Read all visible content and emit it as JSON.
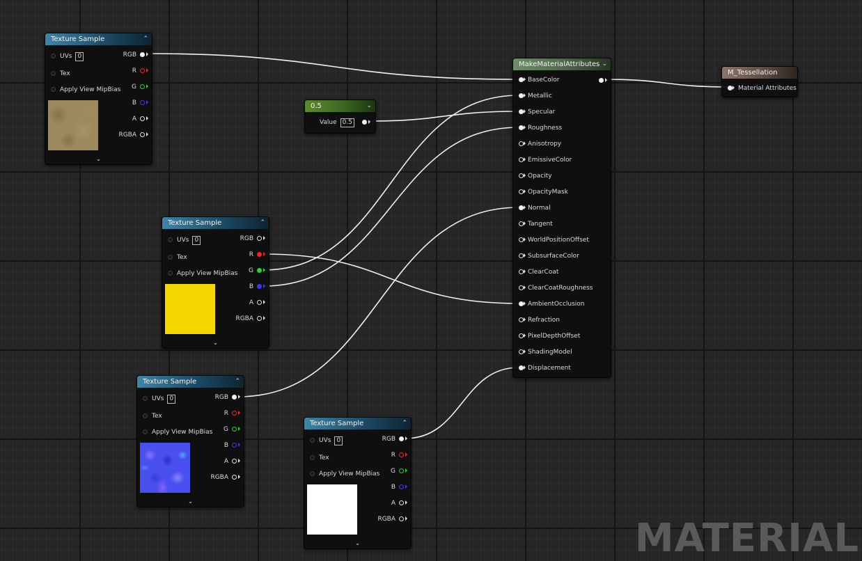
{
  "watermark": "MATERIAL",
  "texture_sample": {
    "title": "Texture Sample",
    "inputs": {
      "uvs": "UVs",
      "uvs_value": "0",
      "tex": "Tex",
      "mip": "Apply View MipBias"
    },
    "outputs": {
      "rgb": "RGB",
      "r": "R",
      "g": "G",
      "b": "B",
      "a": "A",
      "rgba": "RGBA"
    }
  },
  "constant": {
    "title": "0.5",
    "label": "Value",
    "value": "0.5"
  },
  "make_material": {
    "title": "MakeMaterialAttributes",
    "inputs": [
      "BaseColor",
      "Metallic",
      "Specular",
      "Roughness",
      "Anisotropy",
      "EmissiveColor",
      "Opacity",
      "OpacityMask",
      "Normal",
      "Tangent",
      "WorldPositionOffset",
      "SubsurfaceColor",
      "ClearCoat",
      "ClearCoatRoughness",
      "AmbientOcclusion",
      "Refraction",
      "PixelDepthOffset",
      "ShadingModel",
      "Displacement"
    ],
    "connected": [
      0,
      1,
      2,
      3,
      8,
      14,
      18
    ]
  },
  "result": {
    "title": "M_Tessellation",
    "input": "Material Attributes"
  },
  "icons": {
    "collapse": "chevron-up-icon",
    "expand": "chevron-down-icon"
  },
  "colors": {
    "wire": "#f0f0f0",
    "pin_red": "#ff2020",
    "pin_green": "#1fdc1f",
    "pin_blue": "#3a3aff",
    "texture_header": "#3e86a7",
    "constant_header": "#5c8a2e",
    "make_header": "#6f8e6a",
    "result_header": "#8c7668"
  }
}
